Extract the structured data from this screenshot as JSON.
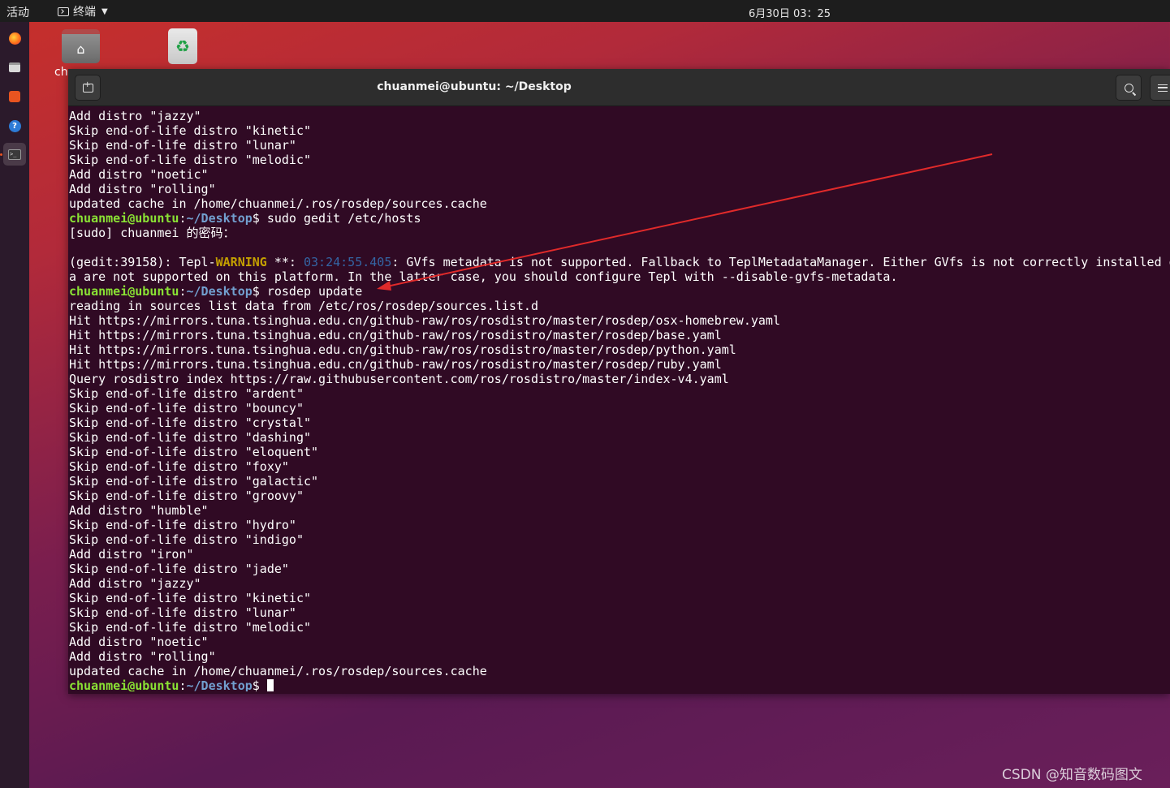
{
  "topbar": {
    "activities": "活动",
    "app_name": "终端",
    "clock": "6月30日 03：25"
  },
  "desktop": {
    "home_label": "ch"
  },
  "terminal": {
    "title": "chuanmei@ubuntu: ~/Desktop",
    "prompt_user": "chuanmei@ubuntu",
    "prompt_colon": ":",
    "prompt_path": "~/Desktop",
    "prompt_dollar": "$",
    "lines": [
      "Add distro \"jazzy\"",
      "Skip end-of-life distro \"kinetic\"",
      "Skip end-of-life distro \"lunar\"",
      "Skip end-of-life distro \"melodic\"",
      "Add distro \"noetic\"",
      "Add distro \"rolling\"",
      "updated cache in /home/chuanmei/.ros/rosdep/sources.cache"
    ],
    "cmd1": " sudo gedit /etc/hosts",
    "sudo_prompt": "[sudo] chuanmei 的密码：",
    "blank": "",
    "gedit_prefix": "(gedit:39158): Tepl-",
    "gedit_warning": "WARNING",
    "gedit_sep": " **: ",
    "gedit_time": "03:24:55.405",
    "gedit_rest": ": GVfs metadata is not supported. Fallback to TeplMetadataManager. Either GVfs is not correctly installed o",
    "gedit_line2": "a are not supported on this platform. In the latter case, you should configure Tepl with --disable-gvfs-metadata.",
    "cmd2": " rosdep update",
    "lines2": [
      "reading in sources list data from /etc/ros/rosdep/sources.list.d",
      "Hit https://mirrors.tuna.tsinghua.edu.cn/github-raw/ros/rosdistro/master/rosdep/osx-homebrew.yaml",
      "Hit https://mirrors.tuna.tsinghua.edu.cn/github-raw/ros/rosdistro/master/rosdep/base.yaml",
      "Hit https://mirrors.tuna.tsinghua.edu.cn/github-raw/ros/rosdistro/master/rosdep/python.yaml",
      "Hit https://mirrors.tuna.tsinghua.edu.cn/github-raw/ros/rosdistro/master/rosdep/ruby.yaml",
      "Query rosdistro index https://raw.githubusercontent.com/ros/rosdistro/master/index-v4.yaml",
      "Skip end-of-life distro \"ardent\"",
      "Skip end-of-life distro \"bouncy\"",
      "Skip end-of-life distro \"crystal\"",
      "Skip end-of-life distro \"dashing\"",
      "Skip end-of-life distro \"eloquent\"",
      "Skip end-of-life distro \"foxy\"",
      "Skip end-of-life distro \"galactic\"",
      "Skip end-of-life distro \"groovy\"",
      "Add distro \"humble\"",
      "Skip end-of-life distro \"hydro\"",
      "Skip end-of-life distro \"indigo\"",
      "Add distro \"iron\"",
      "Skip end-of-life distro \"jade\"",
      "Add distro \"jazzy\"",
      "Skip end-of-life distro \"kinetic\"",
      "Skip end-of-life distro \"lunar\"",
      "Skip end-of-life distro \"melodic\"",
      "Add distro \"noetic\"",
      "Add distro \"rolling\"",
      "updated cache in /home/chuanmei/.ros/rosdep/sources.cache"
    ],
    "cmd3": " "
  },
  "watermark": "CSDN @知音数码图文",
  "colors": {
    "terminal_bg": "#300a24",
    "prompt_user": "#8ae234",
    "prompt_path": "#729fcf",
    "annotation_arrow": "#e02a2a"
  },
  "icons": [
    "firefox-icon",
    "files-icon",
    "software-store-icon",
    "help-icon",
    "terminal-icon",
    "home-folder-icon",
    "trash-icon",
    "new-tab-icon",
    "search-icon",
    "menu-icon"
  ]
}
